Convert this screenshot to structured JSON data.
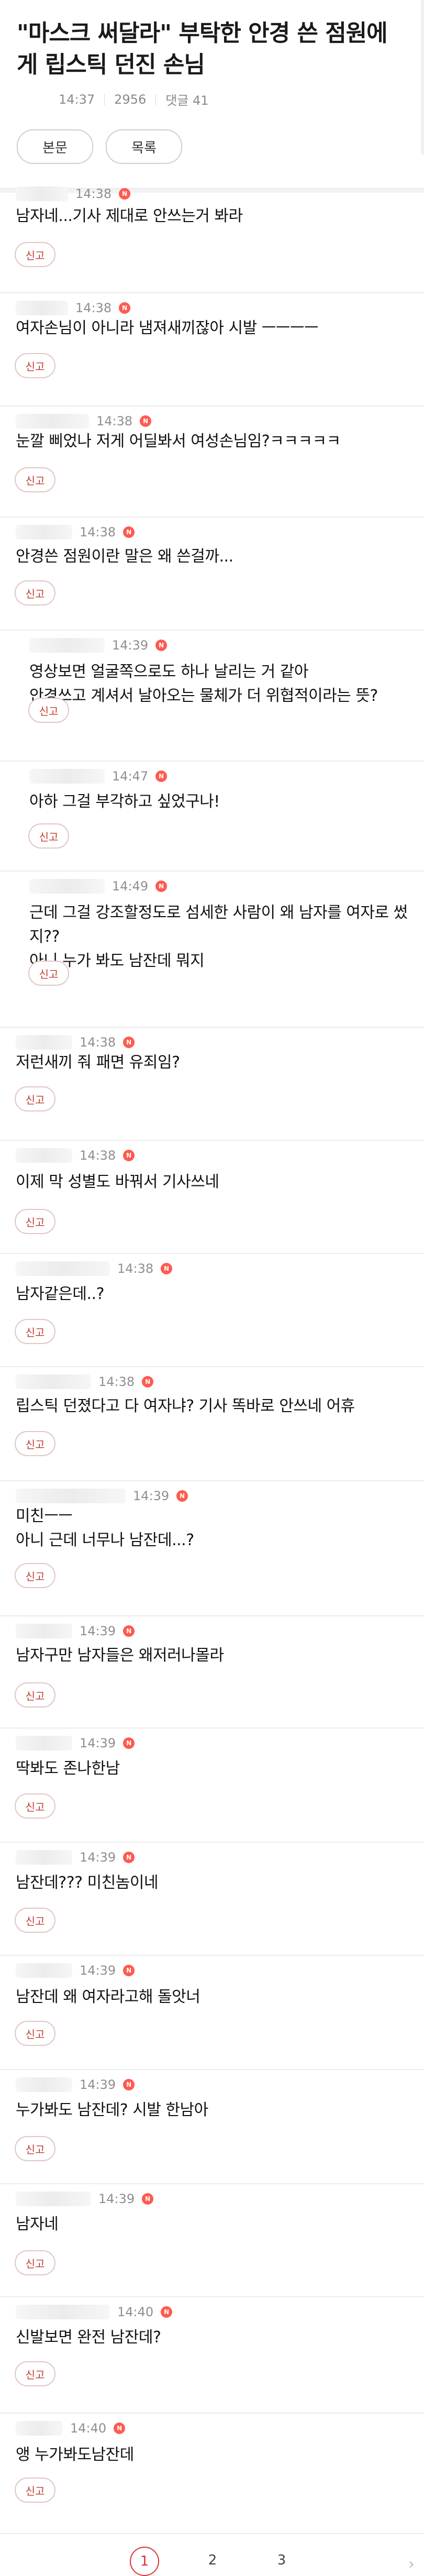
{
  "post": {
    "title": "\"마스크 써달라\" 부탁한 안경 쓴 점원에게 립스틱 던진 손님",
    "time": "14:37",
    "views": "2956",
    "comments_label": "댓글 41"
  },
  "actions": {
    "body_label": "본문",
    "list_label": "목록"
  },
  "report_label": "신고",
  "new_badge": "N",
  "comments": [
    {
      "time": "14:38",
      "text": "남자네...기사 제대로 안쓰는거 봐라"
    },
    {
      "time": "14:38",
      "text": "여자손님이 아니라 냄져새끼잖아 시발 ㅡㅡㅡㅡ"
    },
    {
      "time": "14:38",
      "text": "눈깔 삐었나 저게 어딜봐서 여성손님임?ㅋㅋㅋㅋㅋ"
    },
    {
      "time": "14:38",
      "text": "안경쓴 점원이란 말은 왜 쓴걸까..."
    },
    {
      "time": "14:39",
      "text": "영상보면 얼굴쪽으로도 하나 날리는 거 같아\n안경쓰고 계셔서 날아오는 물체가 더 위협적이라는 뜻?"
    },
    {
      "time": "14:47",
      "text": "아하 그걸 부각하고 싶었구나!"
    },
    {
      "time": "14:49",
      "text": "근데 그걸 강조할정도로 섬세한 사람이 왜 남자를 여자로 썼지??\n아니 누가 봐도 남잔데 뭐지"
    },
    {
      "time": "14:38",
      "text": "저런새끼 줘 패면 유죄임?"
    },
    {
      "time": "14:38",
      "text": "이제 막 성별도 바꿔서 기사쓰네"
    },
    {
      "time": "14:38",
      "text": "남자같은데..?"
    },
    {
      "time": "14:38",
      "text": "립스틱 던졌다고 다 여자냐? 기사 똑바로 안쓰네 어휴"
    },
    {
      "time": "14:39",
      "text": "미친ㅡㅡ\n아니 근데 너무나 남잔데...?"
    },
    {
      "time": "14:39",
      "text": "남자구만 남자들은 왜저러나몰라"
    },
    {
      "time": "14:39",
      "text": "딱봐도 존나한남"
    },
    {
      "time": "14:39",
      "text": "남잔데??? 미친놈이네"
    },
    {
      "time": "14:39",
      "text": "남잔데 왜 여자라고해 돌앗너"
    },
    {
      "time": "14:39",
      "text": "누가봐도 남잔데? 시발 한남아"
    },
    {
      "time": "14:39",
      "text": "남자네"
    },
    {
      "time": "14:40",
      "text": "신발보면 완전 남잔데?"
    },
    {
      "time": "14:40",
      "text": "앵 누가봐도남잔데"
    }
  ],
  "pagination": {
    "pages": [
      "1",
      "2",
      "3"
    ],
    "current": "1",
    "next_label": "›"
  }
}
